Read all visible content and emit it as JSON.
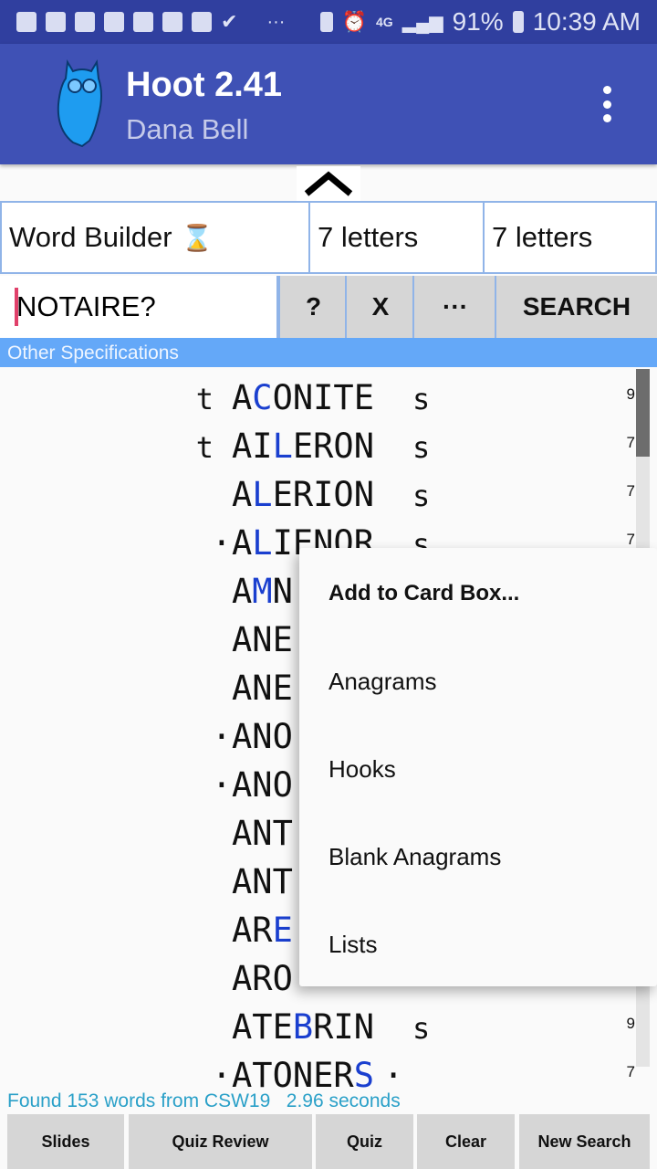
{
  "status_bar": {
    "battery": "91%",
    "time": "10:39 AM",
    "icons": [
      "notes-icon",
      "notes-icon",
      "notes-icon",
      "notes-icon",
      "mail-icon",
      "ifttt-icon",
      "image-icon",
      "checkmark-icon",
      "more-icon",
      "battery-saver-icon",
      "alarm-icon",
      "4g-lte-icon",
      "signal-icon",
      "battery-icon"
    ]
  },
  "app_bar": {
    "title": "Hoot 2.41",
    "subtitle": "Dana Bell",
    "logo": "owl-icon",
    "menu_icon": "overflow-menu-icon"
  },
  "collapse_icon": "chevron-up-icon",
  "search_type": {
    "label": "Word Builder",
    "icon": "⌛"
  },
  "min_length": "7 letters",
  "max_length": "7 letters",
  "query": "NOTAIRE?",
  "buttons": {
    "help": "?",
    "clear_x": "X",
    "more": "···",
    "search": "SEARCH"
  },
  "other_specs": "Other Specifications",
  "accent_color": "#3f51b5",
  "highlight_color": "#1a3fcf",
  "words": [
    {
      "front": "t",
      "word": "ACONITE",
      "blue": 1,
      "back": "s",
      "score": "9"
    },
    {
      "front": "t",
      "word": "AILERON",
      "blue": 2,
      "back": "s",
      "score": "7"
    },
    {
      "front": "",
      "word": "ALERION",
      "blue": 1,
      "back": "s",
      "score": "7"
    },
    {
      "front": "·",
      "word": "ALIENOR",
      "blue": 1,
      "back": "s",
      "score": "7"
    },
    {
      "front": "",
      "word": "AMN",
      "blue": 1,
      "back": "",
      "score": ""
    },
    {
      "front": "",
      "word": "ANE",
      "blue": -1,
      "back": "",
      "score": ""
    },
    {
      "front": "",
      "word": "ANE",
      "blue": -1,
      "back": "",
      "score": ""
    },
    {
      "front": "·",
      "word": "ANO",
      "blue": -1,
      "back": "",
      "score": ""
    },
    {
      "front": "·",
      "word": "ANO",
      "blue": -1,
      "back": "",
      "score": ""
    },
    {
      "front": "",
      "word": "ANT",
      "blue": -1,
      "back": "",
      "score": ""
    },
    {
      "front": "",
      "word": "ANT",
      "blue": -1,
      "back": "",
      "score": ""
    },
    {
      "front": "",
      "word": "ARE",
      "blue": 2,
      "back": "",
      "score": ""
    },
    {
      "front": "",
      "word": "ARO",
      "blue": -1,
      "back": "",
      "score": ""
    },
    {
      "front": "",
      "word": "ATEBRIN",
      "blue": 3,
      "back": "s",
      "score": "9"
    },
    {
      "front": "·",
      "word": "ATONERS",
      "blue": 6,
      "back": "·",
      "score": "7"
    }
  ],
  "context_menu": [
    "Add to Card Box...",
    "Anagrams",
    "Hooks",
    "Blank Anagrams",
    "Lists"
  ],
  "found_text": "Found 153 words from CSW19   2.96 seconds",
  "bottom_buttons": [
    "Slides",
    "Quiz Review",
    "Quiz",
    "Clear",
    "New Search"
  ]
}
